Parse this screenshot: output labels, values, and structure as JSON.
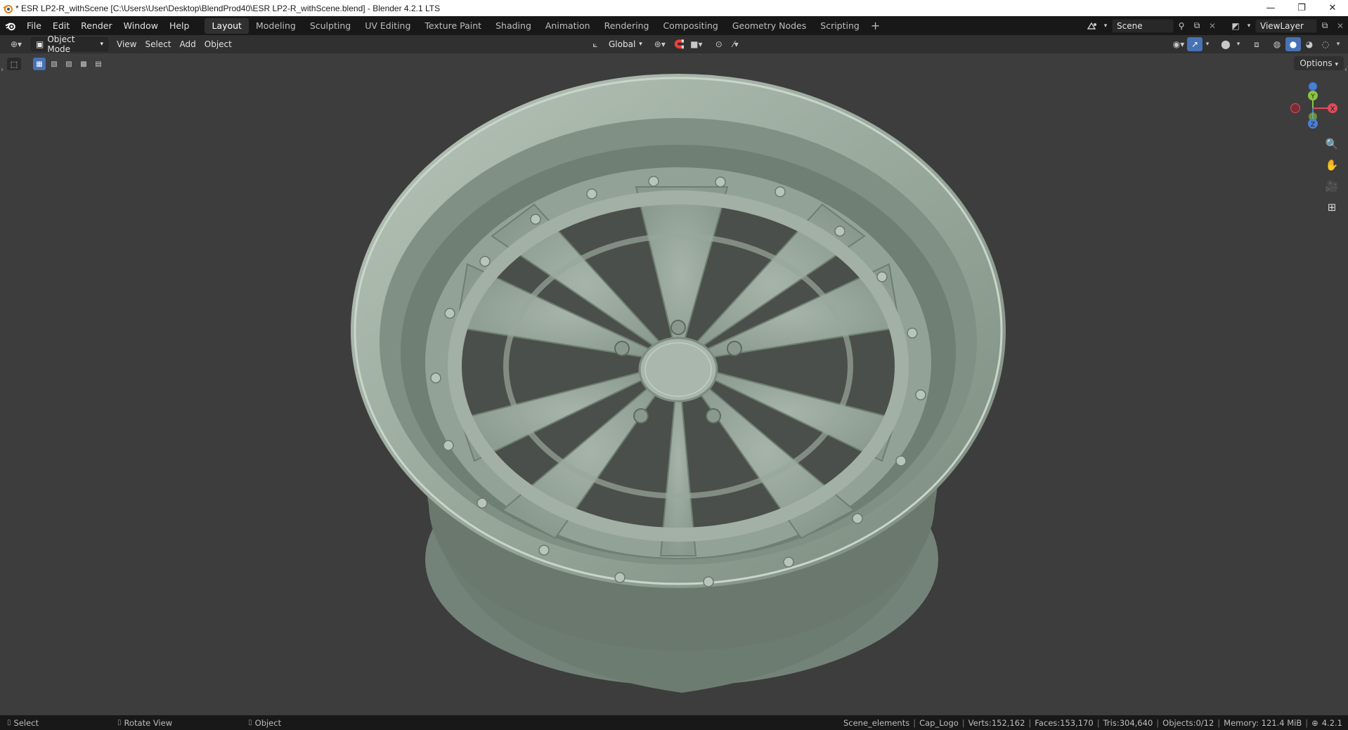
{
  "window": {
    "title": "* ESR LP2-R_withScene [C:\\Users\\User\\Desktop\\BlendProd40\\ESR LP2-R_withScene.blend] - Blender 4.2.1 LTS",
    "min": "—",
    "max": "❐",
    "close": "✕"
  },
  "menu": [
    "File",
    "Edit",
    "Render",
    "Window",
    "Help"
  ],
  "workspaces": [
    {
      "label": "Layout",
      "active": true
    },
    {
      "label": "Modeling"
    },
    {
      "label": "Sculpting"
    },
    {
      "label": "UV Editing"
    },
    {
      "label": "Texture Paint"
    },
    {
      "label": "Shading"
    },
    {
      "label": "Animation"
    },
    {
      "label": "Rendering"
    },
    {
      "label": "Compositing"
    },
    {
      "label": "Geometry Nodes"
    },
    {
      "label": "Scripting"
    }
  ],
  "workspace_add": "+",
  "scene": {
    "label": "Scene",
    "view_layer": "ViewLayer"
  },
  "header": {
    "mode": "Object Mode",
    "view": "View",
    "select": "Select",
    "add": "Add",
    "object": "Object",
    "transform_orientation": "Global"
  },
  "viewport": {
    "options": "Options",
    "gizmo": {
      "x": "X",
      "y": "Y",
      "z": "Z"
    }
  },
  "statusbar": {
    "select": "Select",
    "rotate": "Rotate View",
    "object": "Object",
    "collection": "Scene_elements",
    "active": "Cap_Logo",
    "verts": "Verts:152,162",
    "faces": "Faces:153,170",
    "tris": "Tris:304,640",
    "objects": "Objects:0/12",
    "memory": "Memory: 121.4 MiB",
    "version": "4.2.1"
  },
  "colors": {
    "titlebar": "#ffffff",
    "topbar": "#181818",
    "header": "#303030",
    "viewport_bg": "#3d3d3d",
    "wheel": "#9aaa9d",
    "accent": "#4772b3",
    "axis_x": "#e24a5b",
    "axis_y": "#8bc53f",
    "axis_z": "#4a7fd4"
  }
}
